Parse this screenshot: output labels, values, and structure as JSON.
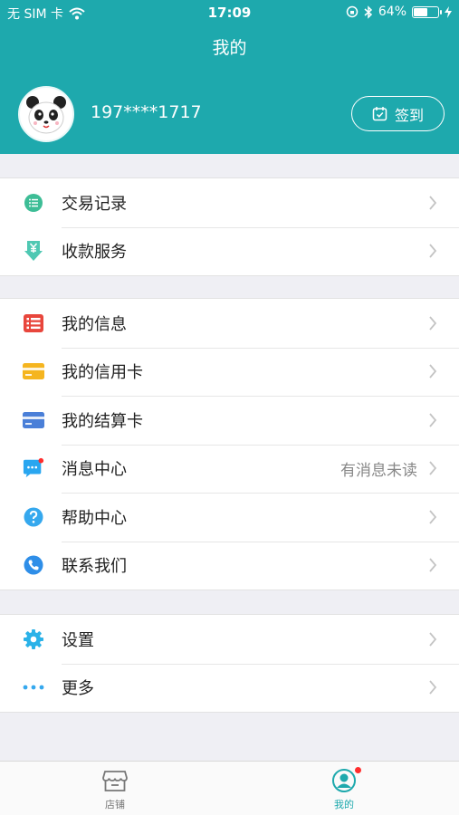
{
  "status_bar": {
    "carrier": "无 SIM 卡",
    "time": "17:09",
    "battery": "64%",
    "battery_level": 0.64
  },
  "header": {
    "title": "我的",
    "phone": "197****1717",
    "signin_label": "签到"
  },
  "groups": [
    {
      "items": [
        {
          "label": "交易记录",
          "icon": "list-circle-icon"
        },
        {
          "label": "收款服务",
          "icon": "yen-arrow-icon"
        }
      ]
    },
    {
      "items": [
        {
          "label": "我的信息",
          "icon": "info-list-icon"
        },
        {
          "label": "我的信用卡",
          "icon": "credit-card-icon"
        },
        {
          "label": "我的结算卡",
          "icon": "debit-card-icon"
        },
        {
          "label": "消息中心",
          "icon": "message-icon",
          "aux": "有消息未读"
        },
        {
          "label": "帮助中心",
          "icon": "help-icon"
        },
        {
          "label": "联系我们",
          "icon": "phone-icon"
        }
      ]
    },
    {
      "items": [
        {
          "label": "设置",
          "icon": "gear-icon"
        },
        {
          "label": "更多",
          "icon": "more-icon"
        }
      ]
    }
  ],
  "tabbar": {
    "store_label": "店铺",
    "mine_label": "我的"
  },
  "colors": {
    "brand": "#1ea9ad",
    "background": "#efeff4"
  }
}
